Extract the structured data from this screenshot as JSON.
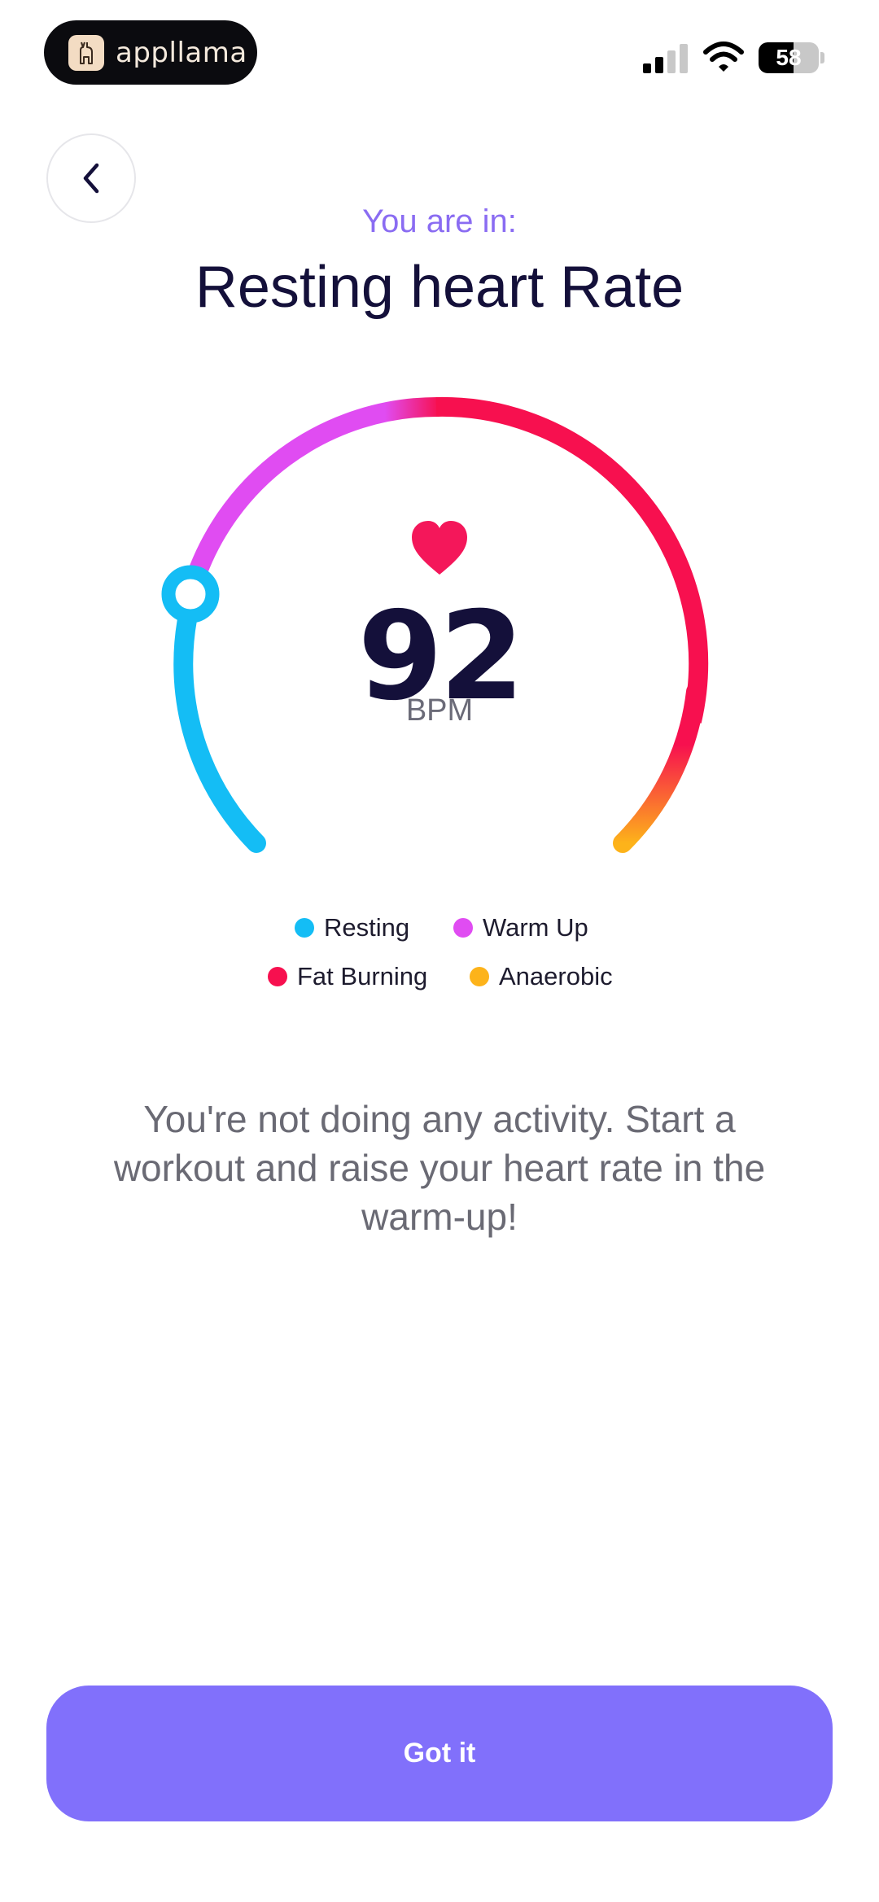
{
  "status_bar": {
    "app_pill_label": "appllama",
    "battery_level": "58",
    "battery_fraction": 0.58
  },
  "header": {
    "subtitle": "You are in:",
    "title": "Resting heart Rate"
  },
  "gauge": {
    "bpm_value": "92",
    "bpm_unit": "BPM",
    "zones": [
      {
        "name": "Resting",
        "color": "#14bdf5"
      },
      {
        "name": "Warm Up",
        "color": "#e04cf2"
      },
      {
        "name": "Fat Burning",
        "color": "#f7104f"
      },
      {
        "name": "Anaerobic",
        "color": "#fdb31a"
      }
    ],
    "heart_color": "#f4175a"
  },
  "legend": {
    "items": [
      {
        "label": "Resting",
        "color": "#14bdf5"
      },
      {
        "label": "Warm Up",
        "color": "#e04cf2"
      },
      {
        "label": "Fat Burning",
        "color": "#f7104f"
      },
      {
        "label": "Anaerobic",
        "color": "#fdb31a"
      }
    ]
  },
  "message": "You're not doing any activity. Start a workout and raise your heart rate in the warm-up!",
  "primary_button": {
    "label": "Got it",
    "color": "#8170fb"
  },
  "icons": {
    "back": "chevron-left-icon",
    "heart": "heart-icon",
    "signal": "cellular-signal-icon",
    "wifi": "wifi-icon",
    "battery": "battery-icon"
  }
}
